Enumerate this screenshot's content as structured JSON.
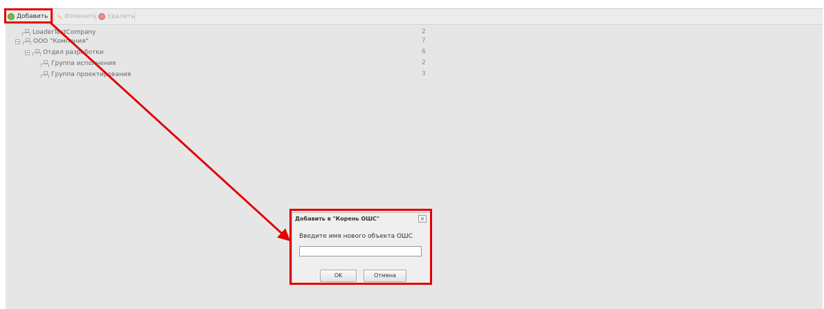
{
  "toolbar": {
    "add_label": "Добавить",
    "edit_label": "Изменить",
    "delete_label": "Удалить"
  },
  "tree": {
    "items": [
      {
        "label": "LoaderTestCompany",
        "count": "2"
      },
      {
        "label": "ООО \"Компания\"",
        "count": "7"
      },
      {
        "label": "Отдел разработки",
        "count": "6"
      },
      {
        "label": "Группа исполнения",
        "count": "2"
      },
      {
        "label": "Группа проектирования",
        "count": "3"
      }
    ]
  },
  "dialog": {
    "title": "Добавить в \"Корень ОШС\"",
    "prompt": "Введите имя нового объекта ОШС",
    "input_value": "",
    "ok_label": "OK",
    "cancel_label": "Отмена",
    "close_glyph": "×"
  },
  "annotation": {
    "color": "#e10000"
  }
}
